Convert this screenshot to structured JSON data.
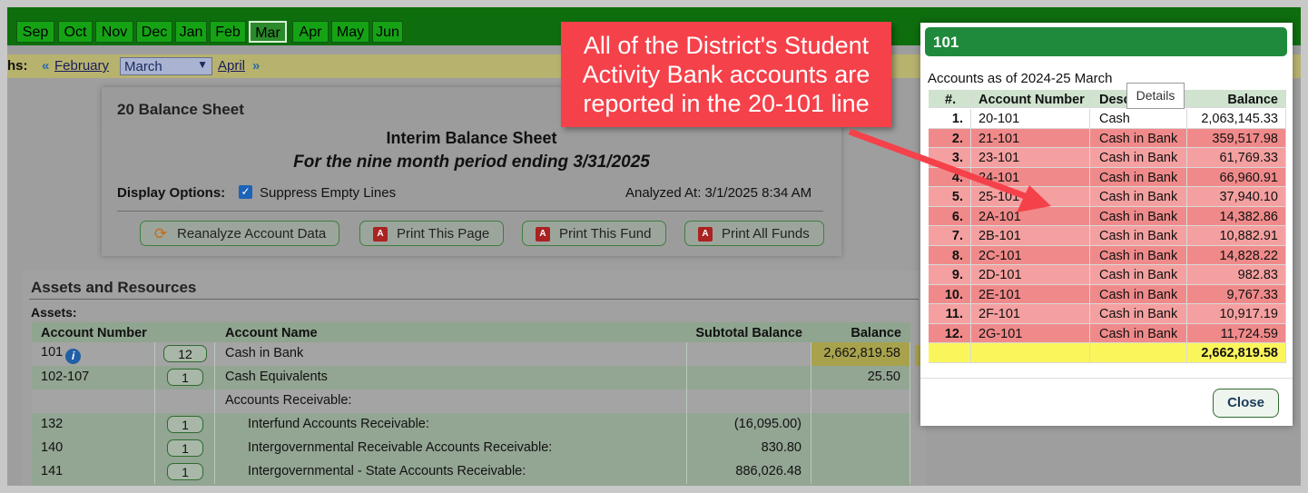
{
  "months": {
    "tabs": [
      "Sep",
      "Oct",
      "Nov",
      "Dec",
      "Jan",
      "Feb",
      "Mar",
      "Apr",
      "May",
      "Jun"
    ],
    "selected": "Mar"
  },
  "nav": {
    "label": "hs:",
    "prev": "February",
    "current": "March",
    "next": "April"
  },
  "balance_card": {
    "header": "20 Balance Sheet",
    "title": "Interim Balance Sheet",
    "period": "For the nine month period ending 3/31/2025",
    "display_options_label": "Display Options:",
    "suppress_label": "Suppress Empty Lines",
    "analyzed": "Analyzed At: 3/1/2025 8:34 AM",
    "buttons": {
      "reanalyze": "Reanalyze Account Data",
      "print_page": "Print This Page",
      "print_fund": "Print This Fund",
      "print_all": "Print All Funds"
    }
  },
  "assets": {
    "section_title": "Assets and Resources",
    "subtitle": "Assets:",
    "headers": {
      "account_number": "Account Number",
      "account_name": "Account Name",
      "subtotal": "Subtotal Balance",
      "balance": "Balance"
    },
    "rows": [
      {
        "account": "101",
        "count": "12",
        "name": "Cash in Bank",
        "subtotal": "",
        "balance": "2,662,819.58"
      },
      {
        "account": "102-107",
        "count": "1",
        "name": "Cash Equivalents",
        "subtotal": "",
        "balance": "25.50"
      },
      {
        "account": "",
        "count": "",
        "name": "Accounts Receivable:",
        "subtotal": "",
        "balance": ""
      },
      {
        "account": "132",
        "count": "1",
        "name": "Interfund Accounts Receivable:",
        "subtotal": "(16,095.00)",
        "balance": ""
      },
      {
        "account": "140",
        "count": "1",
        "name": "Intergovernmental Receivable Accounts Receivable:",
        "subtotal": "830.80",
        "balance": ""
      },
      {
        "account": "141",
        "count": "1",
        "name": "Intergovernmental - State Accounts Receivable:",
        "subtotal": "886,026.48",
        "balance": ""
      }
    ]
  },
  "modal": {
    "title": "101",
    "subtitle": "Accounts as of 2024-25 March",
    "headers": {
      "num": "#.",
      "account": "Account Number",
      "desc": "Desc",
      "balance": "Balance"
    },
    "tooltip": "Details",
    "rows": [
      {
        "num": "1.",
        "account": "20-101",
        "desc": "Cash",
        "balance": "2,063,145.33"
      },
      {
        "num": "2.",
        "account": "21-101",
        "desc": "Cash in Bank",
        "balance": "359,517.98"
      },
      {
        "num": "3.",
        "account": "23-101",
        "desc": "Cash in Bank",
        "balance": "61,769.33"
      },
      {
        "num": "4.",
        "account": "24-101",
        "desc": "Cash in Bank",
        "balance": "66,960.91"
      },
      {
        "num": "5.",
        "account": "25-101",
        "desc": "Cash in Bank",
        "balance": "37,940.10"
      },
      {
        "num": "6.",
        "account": "2A-101",
        "desc": "Cash in Bank",
        "balance": "14,382.86"
      },
      {
        "num": "7.",
        "account": "2B-101",
        "desc": "Cash in Bank",
        "balance": "10,882.91"
      },
      {
        "num": "8.",
        "account": "2C-101",
        "desc": "Cash in Bank",
        "balance": "14,828.22"
      },
      {
        "num": "9.",
        "account": "2D-101",
        "desc": "Cash in Bank",
        "balance": "982.83"
      },
      {
        "num": "10.",
        "account": "2E-101",
        "desc": "Cash in Bank",
        "balance": "9,767.33"
      },
      {
        "num": "11.",
        "account": "2F-101",
        "desc": "Cash in Bank",
        "balance": "10,917.19"
      },
      {
        "num": "12.",
        "account": "2G-101",
        "desc": "Cash in Bank",
        "balance": "11,724.59"
      }
    ],
    "total": "2,662,819.58",
    "close": "Close"
  },
  "callout": {
    "text": "All of the District's Student Activity Bank accounts are reported in the 20-101 line"
  },
  "colors": {
    "month_bar": "#0e6e0e",
    "month_tab": "#15a315",
    "modal_header": "#1f8a3c",
    "row_red": "#f08a8a",
    "total_yellow": "#fbf55c",
    "callout": "#f5414a"
  }
}
